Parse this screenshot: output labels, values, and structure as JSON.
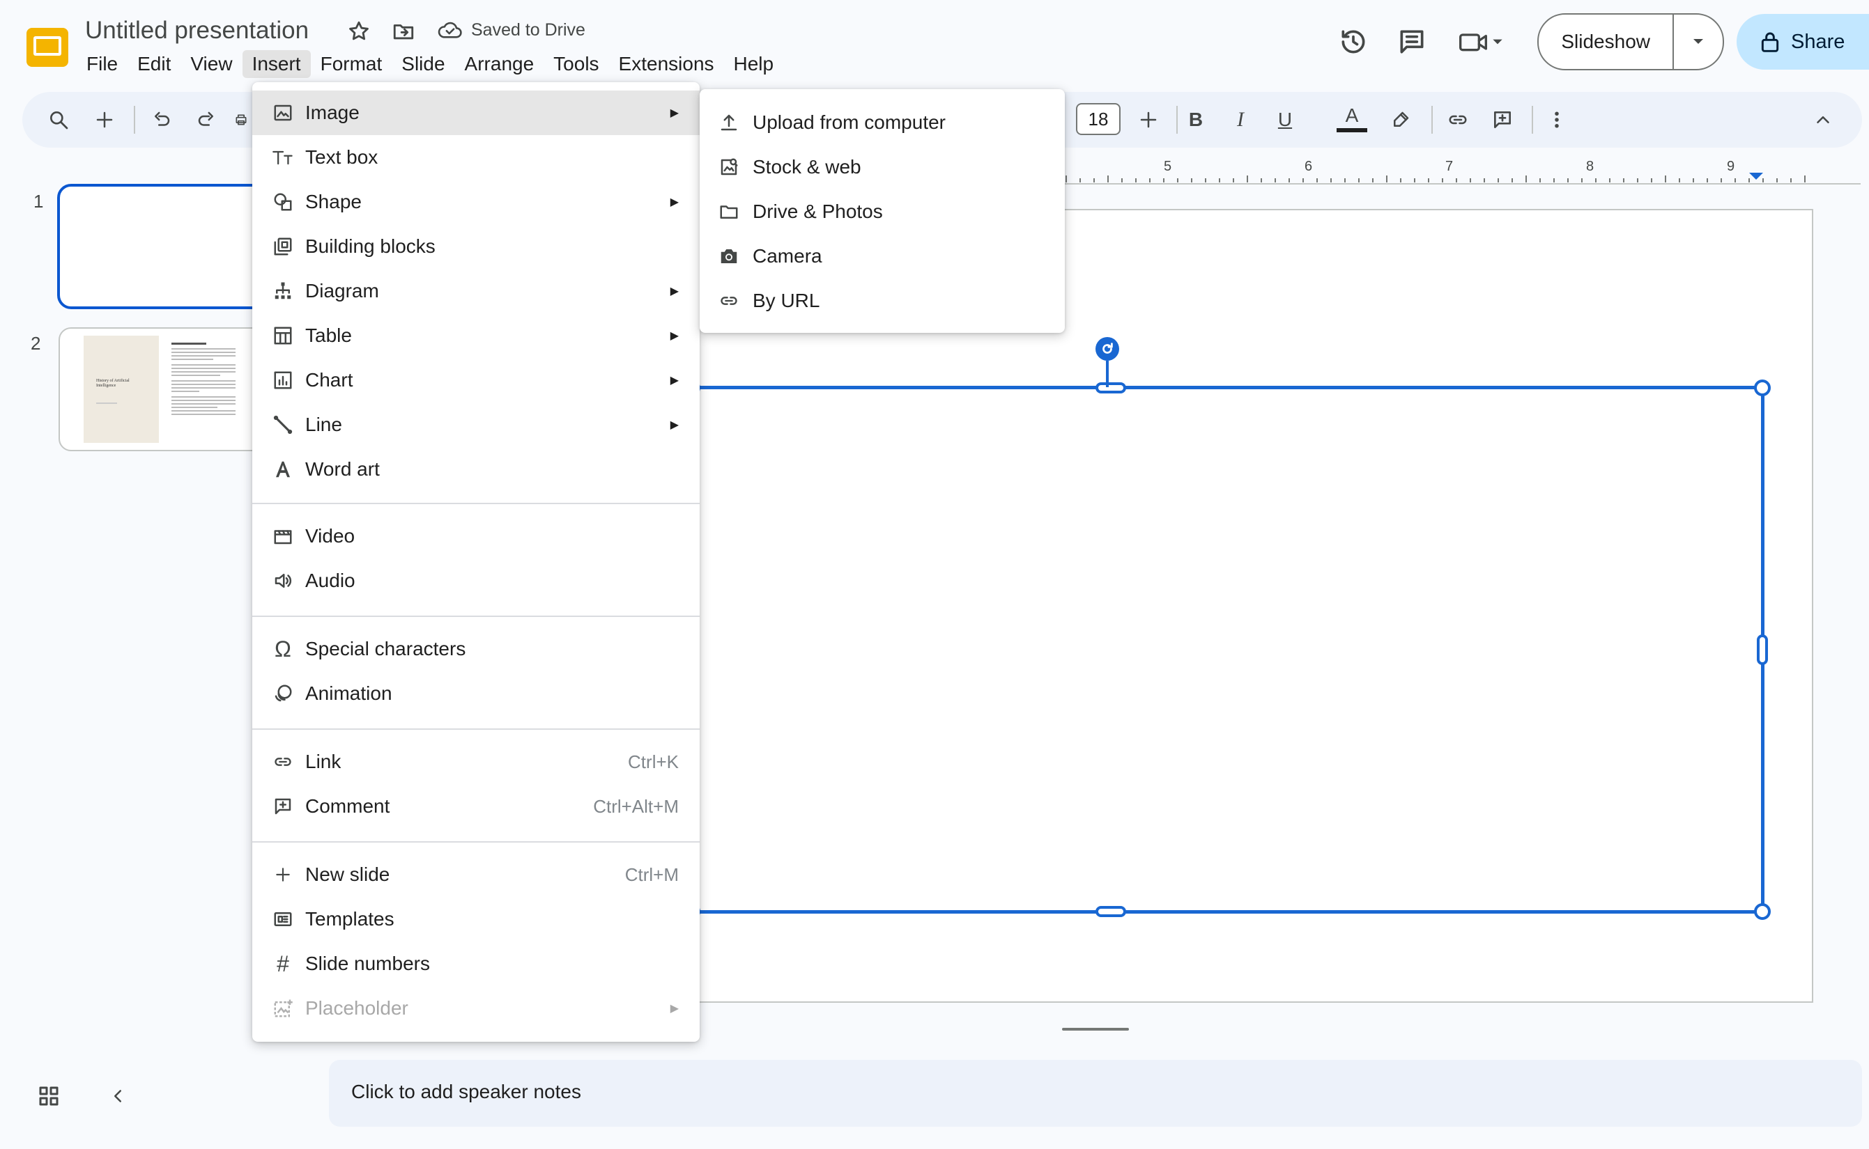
{
  "app": {
    "title": "Untitled presentation",
    "saved_status": "Saved to Drive",
    "menus": [
      "File",
      "Edit",
      "View",
      "Insert",
      "Format",
      "Slide",
      "Arrange",
      "Tools",
      "Extensions",
      "Help"
    ],
    "active_menu": "Insert"
  },
  "header_right": {
    "slideshow_label": "Slideshow",
    "share_label": "Share"
  },
  "toolbar": {
    "font_size": "18",
    "bold": "B",
    "italic": "I",
    "underline": "U",
    "text_color_glyph": "A"
  },
  "ruler": {
    "ticks": [
      "5",
      "6",
      "7",
      "8",
      "9"
    ]
  },
  "filmstrip": {
    "slides": [
      {
        "number": "1",
        "selected": true
      },
      {
        "number": "2",
        "selected": false,
        "thumb_title": "History of Artificial Intelligence"
      }
    ]
  },
  "insert_menu": {
    "items": [
      {
        "label": "Image",
        "icon": "image-icon",
        "submenu": true,
        "highlighted": true
      },
      {
        "label": "Text box",
        "icon": "text-box-icon"
      },
      {
        "label": "Shape",
        "icon": "shape-icon",
        "submenu": true
      },
      {
        "label": "Building blocks",
        "icon": "building-blocks-icon"
      },
      {
        "label": "Diagram",
        "icon": "diagram-icon",
        "submenu": true
      },
      {
        "label": "Table",
        "icon": "table-icon",
        "submenu": true
      },
      {
        "label": "Chart",
        "icon": "chart-icon",
        "submenu": true
      },
      {
        "label": "Line",
        "icon": "line-icon",
        "submenu": true
      },
      {
        "label": "Word art",
        "icon": "word-art-icon"
      },
      {
        "label": "Video",
        "icon": "video-icon"
      },
      {
        "label": "Audio",
        "icon": "audio-icon"
      },
      {
        "label": "Special characters",
        "icon": "omega-icon"
      },
      {
        "label": "Animation",
        "icon": "animation-icon"
      },
      {
        "label": "Link",
        "icon": "link-icon",
        "shortcut": "Ctrl+K"
      },
      {
        "label": "Comment",
        "icon": "add-comment-icon",
        "shortcut": "Ctrl+Alt+M"
      },
      {
        "label": "New slide",
        "icon": "plus-icon",
        "shortcut": "Ctrl+M"
      },
      {
        "label": "Templates",
        "icon": "templates-icon"
      },
      {
        "label": "Slide numbers",
        "icon": "hash-icon"
      },
      {
        "label": "Placeholder",
        "icon": "placeholder-icon",
        "submenu": true,
        "disabled": true
      }
    ]
  },
  "image_submenu": {
    "items": [
      {
        "label": "Upload from computer",
        "icon": "upload-icon"
      },
      {
        "label": "Stock & web",
        "icon": "stock-image-icon"
      },
      {
        "label": "Drive & Photos",
        "icon": "folder-icon"
      },
      {
        "label": "Camera",
        "icon": "camera-icon"
      },
      {
        "label": "By URL",
        "icon": "link-icon"
      }
    ]
  },
  "notes": {
    "placeholder": "Click to add speaker notes"
  },
  "colors": {
    "accent_blue": "#1967d2",
    "share_bg": "#c2e7ff",
    "toolbar_bg": "#edf2fa",
    "logo_yellow": "#f4b400"
  }
}
